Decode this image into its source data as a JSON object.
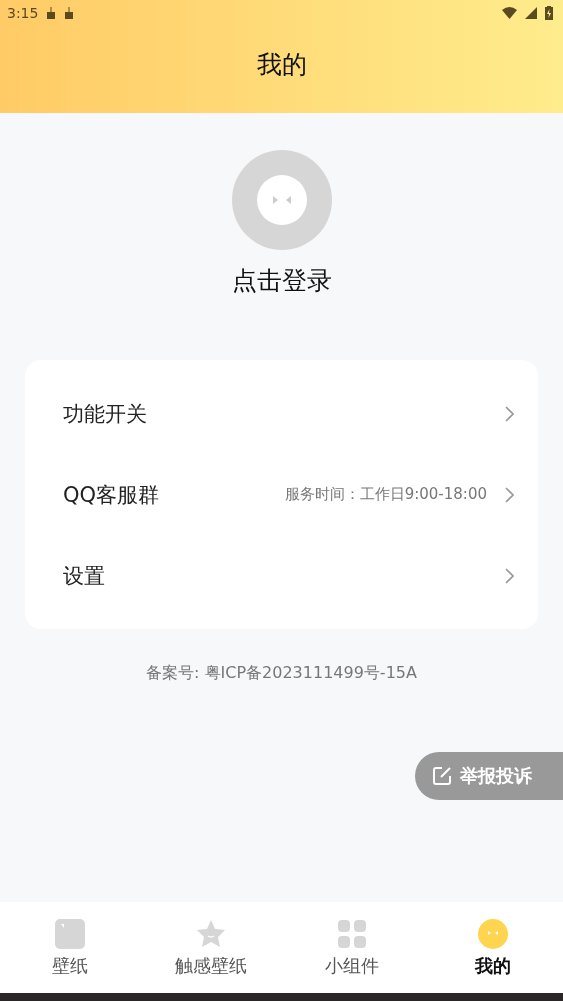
{
  "status_bar": {
    "time": "3:15"
  },
  "header": {
    "title": "我的"
  },
  "profile": {
    "login_label": "点击登录"
  },
  "menu": [
    {
      "label": "功能开关"
    },
    {
      "label": "QQ客服群",
      "detail": "服务时间：工作日9:00-18:00"
    },
    {
      "label": "设置"
    }
  ],
  "icp": "备案号: 粤ICP备2023111499号-15A",
  "report_button": {
    "label": "举报投诉"
  },
  "bottom_nav": [
    {
      "label": "壁纸",
      "kind": "wallpaper",
      "selected": false
    },
    {
      "label": "触感壁纸",
      "kind": "star",
      "selected": false
    },
    {
      "label": "小组件",
      "kind": "grid",
      "selected": false
    },
    {
      "label": "我的",
      "kind": "face",
      "selected": true
    }
  ]
}
